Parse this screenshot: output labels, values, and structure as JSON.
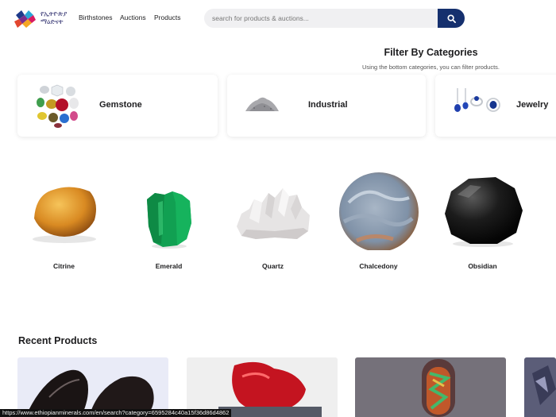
{
  "header": {
    "logo_line1": "የኢትዮጵያ",
    "logo_line2": "ማዕድናት",
    "nav": [
      {
        "label": "Birthstones"
      },
      {
        "label": "Auctions"
      },
      {
        "label": "Products"
      }
    ],
    "search_placeholder": "search for products & auctions...",
    "search_icon": "magnifier-icon"
  },
  "filter": {
    "title": "Filter By Categories",
    "subtitle": "Using the bottom categories, you can filter products.",
    "categories": [
      {
        "label": "Gemstone"
      },
      {
        "label": "Industrial"
      },
      {
        "label": "Jewelry"
      }
    ]
  },
  "stones": [
    {
      "label": "Citrine"
    },
    {
      "label": "Emerald"
    },
    {
      "label": "Quartz"
    },
    {
      "label": "Chalcedony"
    },
    {
      "label": "Obsidian"
    }
  ],
  "recent": {
    "title": "Recent Products"
  },
  "status_bar": {
    "url": "https://www.ethiopianminerals.com/en/search?category=6595284c40a15f36d86d4862"
  },
  "colors": {
    "brand_navy": "#15306e",
    "search_bg": "#f0f0f2",
    "text": "#1d1d1f"
  }
}
